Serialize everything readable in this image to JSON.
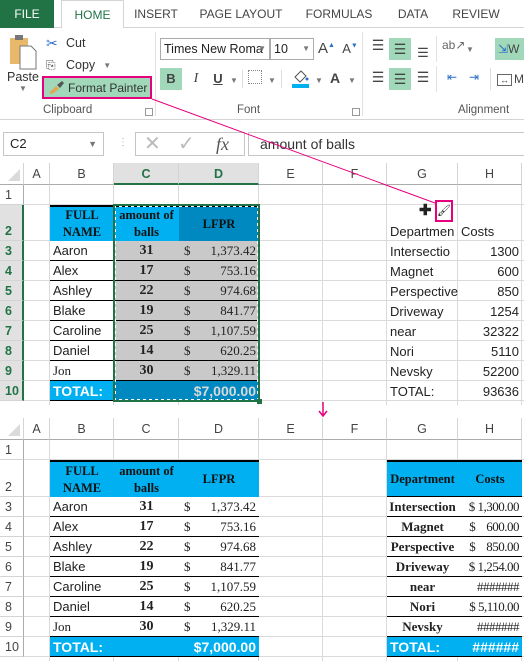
{
  "ribbon": {
    "tabs": [
      "FILE",
      "HOME",
      "INSERT",
      "PAGE LAYOUT",
      "FORMULAS",
      "DATA",
      "REVIEW"
    ],
    "active_tab": "HOME",
    "clipboard": {
      "paste_label": "Paste",
      "cut_label": "Cut",
      "copy_label": "Copy",
      "format_painter_label": "Format Painter",
      "group_label": "Clipboard"
    },
    "font": {
      "font_name": "Times New Roma",
      "font_size": "10",
      "bold_label": "B",
      "italic_label": "I",
      "underline_label": "U",
      "grow_label": "A",
      "shrink_label": "A",
      "font_color_label": "A",
      "group_label": "Font"
    },
    "alignment": {
      "group_label": "Alignment",
      "wrap_label": "W",
      "merge_label": "M"
    }
  },
  "formula_bar": {
    "name_box": "C2",
    "cancel_icon": "✕",
    "enter_icon": "✓",
    "fx_label": "fx",
    "formula": "amount of balls"
  },
  "columns": [
    "A",
    "B",
    "C",
    "D",
    "E",
    "F",
    "G",
    "H"
  ],
  "rows": [
    "1",
    "2",
    "3",
    "4",
    "5",
    "6",
    "7",
    "8",
    "9",
    "10"
  ],
  "annotation": {
    "arrow_color": "#e6007e",
    "highlight_color": "#e6007e"
  },
  "colors": {
    "header_fill": "#00b0f0",
    "selected_header_fill": "#0089c1",
    "selected_body_fill": "#c9c9c9",
    "excel_green": "#217346"
  },
  "main_table": {
    "headers": [
      "FULL NAME",
      "amount of balls",
      "LFPR"
    ],
    "rows": [
      {
        "name": "Aaron",
        "balls": "31",
        "currency": "$",
        "lfpr": "1,373.42"
      },
      {
        "name": "Alex",
        "balls": "17",
        "currency": "$",
        "lfpr": "753.16"
      },
      {
        "name": "Ashley",
        "balls": "22",
        "currency": "$",
        "lfpr": "974.68"
      },
      {
        "name": "Blake",
        "balls": "19",
        "currency": "$",
        "lfpr": "841.77"
      },
      {
        "name": "Caroline",
        "balls": "25",
        "currency": "$",
        "lfpr": "1,107.59"
      },
      {
        "name": "Daniel",
        "balls": "14",
        "currency": "$",
        "lfpr": "620.25"
      },
      {
        "name": "Jon",
        "balls": "30",
        "currency": "$",
        "lfpr": "1,329.11"
      }
    ],
    "total_label": "TOTAL:",
    "total_value": "$7,000.00"
  },
  "before": {
    "dept_table": {
      "headers": [
        "Departmen",
        "Costs"
      ],
      "rows": [
        {
          "dept": "Intersectio",
          "cost": "1300"
        },
        {
          "dept": "Magnet",
          "cost": "600"
        },
        {
          "dept": "Perspective",
          "cost": "850"
        },
        {
          "dept": "Driveway",
          "cost": "1254"
        },
        {
          "dept": "near",
          "cost": "32322"
        },
        {
          "dept": "Nori",
          "cost": "5110"
        },
        {
          "dept": "Nevsky",
          "cost": "52200"
        }
      ],
      "total_label": "TOTAL:",
      "total_value": "93636"
    }
  },
  "after": {
    "dept_table": {
      "headers": [
        "Department",
        "Costs"
      ],
      "rows": [
        {
          "dept": "Intersection",
          "cost": "$ 1,300.00"
        },
        {
          "dept": "Magnet",
          "cost": "$    600.00"
        },
        {
          "dept": "Perspective",
          "cost": "$    850.00"
        },
        {
          "dept": "Driveway",
          "cost": "$ 1,254.00"
        },
        {
          "dept": "near",
          "cost": "#######"
        },
        {
          "dept": "Nori",
          "cost": "$ 5,110.00"
        },
        {
          "dept": "Nevsky",
          "cost": "#######"
        }
      ],
      "total_label": "TOTAL:",
      "total_value": "######"
    }
  }
}
